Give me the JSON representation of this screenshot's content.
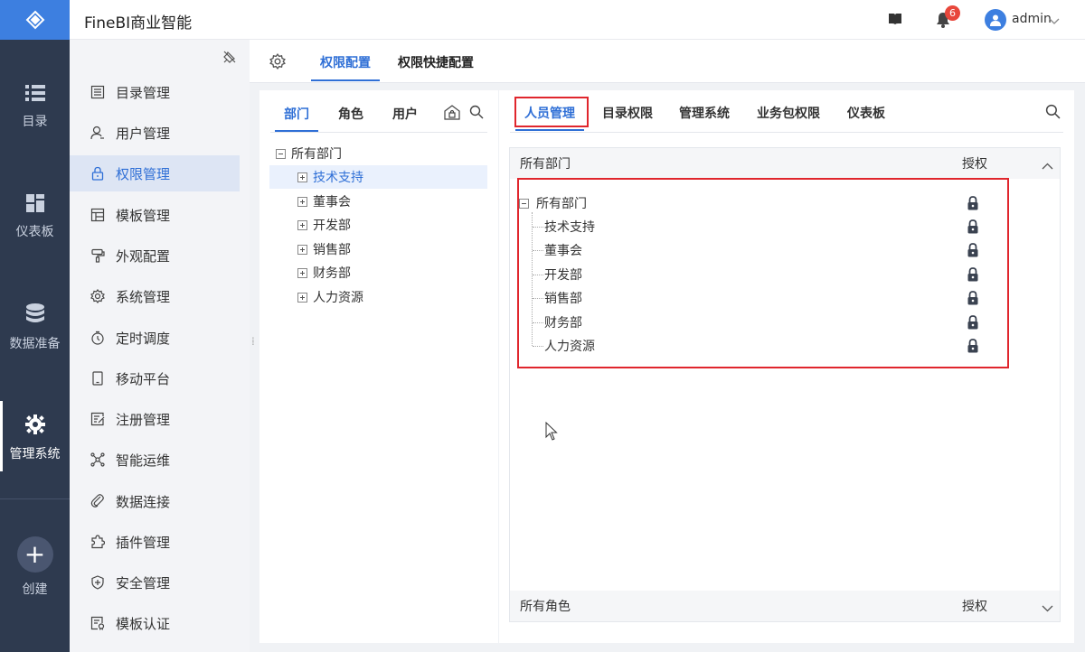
{
  "app": {
    "title": "FineBI商业智能"
  },
  "rail": {
    "items": [
      {
        "label": "目录",
        "icon": "list-icon"
      },
      {
        "label": "仪表板",
        "icon": "dashboard-icon"
      },
      {
        "label": "数据准备",
        "icon": "database-icon"
      },
      {
        "label": "管理系统",
        "icon": "gear-icon",
        "active": true
      }
    ],
    "create_label": "创建"
  },
  "topbar": {
    "notification_count": "6",
    "username": "admin"
  },
  "menu": {
    "items": [
      {
        "label": "目录管理",
        "icon": "catalog-icon"
      },
      {
        "label": "用户管理",
        "icon": "user-icon"
      },
      {
        "label": "权限管理",
        "icon": "lock-icon",
        "active": true
      },
      {
        "label": "模板管理",
        "icon": "template-icon"
      },
      {
        "label": "外观配置",
        "icon": "brush-icon"
      },
      {
        "label": "系统管理",
        "icon": "settings-icon"
      },
      {
        "label": "定时调度",
        "icon": "timer-icon"
      },
      {
        "label": "移动平台",
        "icon": "mobile-icon"
      },
      {
        "label": "注册管理",
        "icon": "register-icon"
      },
      {
        "label": "智能运维",
        "icon": "network-icon"
      },
      {
        "label": "数据连接",
        "icon": "link-icon"
      },
      {
        "label": "插件管理",
        "icon": "puzzle-icon"
      },
      {
        "label": "安全管理",
        "icon": "shield-icon"
      },
      {
        "label": "模板认证",
        "icon": "certificate-icon"
      }
    ]
  },
  "content_tabs": [
    {
      "label": "权限配置",
      "active": true
    },
    {
      "label": "权限快捷配置"
    }
  ],
  "dept_panel": {
    "tabs": [
      {
        "label": "部门",
        "active": true
      },
      {
        "label": "角色"
      },
      {
        "label": "用户"
      }
    ],
    "root": "所有部门",
    "departments": [
      "技术支持",
      "董事会",
      "开发部",
      "销售部",
      "财务部",
      "人力资源"
    ],
    "selected": "技术支持"
  },
  "right_panel": {
    "tabs": [
      {
        "label": "人员管理",
        "active": true
      },
      {
        "label": "目录权限"
      },
      {
        "label": "管理系统"
      },
      {
        "label": "业务包权限"
      },
      {
        "label": "仪表板"
      }
    ],
    "sections": {
      "departments": {
        "title": "所有部门",
        "auth_label": "授权",
        "expanded": true
      },
      "roles": {
        "title": "所有角色",
        "auth_label": "授权",
        "expanded": false
      }
    },
    "auth_tree": {
      "root": "所有部门",
      "children": [
        "技术支持",
        "董事会",
        "开发部",
        "销售部",
        "财务部",
        "人力资源"
      ],
      "lock_state": "locked"
    }
  },
  "colors": {
    "accent": "#2f6fd6",
    "rail_bg": "#2e3a4f",
    "highlight_box": "#e0262d",
    "badge": "#e8473b"
  }
}
